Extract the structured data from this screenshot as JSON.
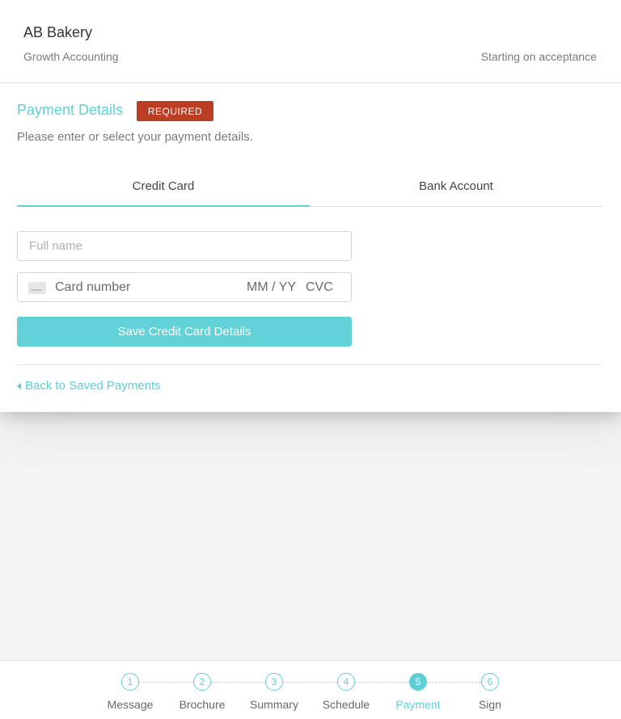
{
  "header": {
    "company": "AB Bakery",
    "service": "Growth Accounting",
    "start": "Starting on acceptance"
  },
  "payment": {
    "title": "Payment Details",
    "required_badge": "REQUIRED",
    "instructions": "Please enter or select your payment details.",
    "tabs": [
      {
        "label": "Credit Card",
        "active": true
      },
      {
        "label": "Bank Account",
        "active": false
      }
    ],
    "full_name_placeholder": "Full name",
    "card_number_placeholder": "Card number",
    "expiry_placeholder": "MM / YY",
    "cvc_placeholder": "CVC",
    "save_button": "Save Credit Card Details",
    "back_link": "Back to Saved Payments"
  },
  "steps": [
    {
      "number": "1",
      "label": "Message"
    },
    {
      "number": "2",
      "label": "Brochure"
    },
    {
      "number": "3",
      "label": "Summary"
    },
    {
      "number": "4",
      "label": "Schedule"
    },
    {
      "number": "5",
      "label": "Payment",
      "current": true
    },
    {
      "number": "6",
      "label": "Sign"
    }
  ],
  "colors": {
    "accent": "#5fcfd6",
    "required": "#bb3d24",
    "button": "#62d2d8"
  },
  "icons": {
    "card": "credit-card-icon",
    "back": "caret-left-icon"
  }
}
